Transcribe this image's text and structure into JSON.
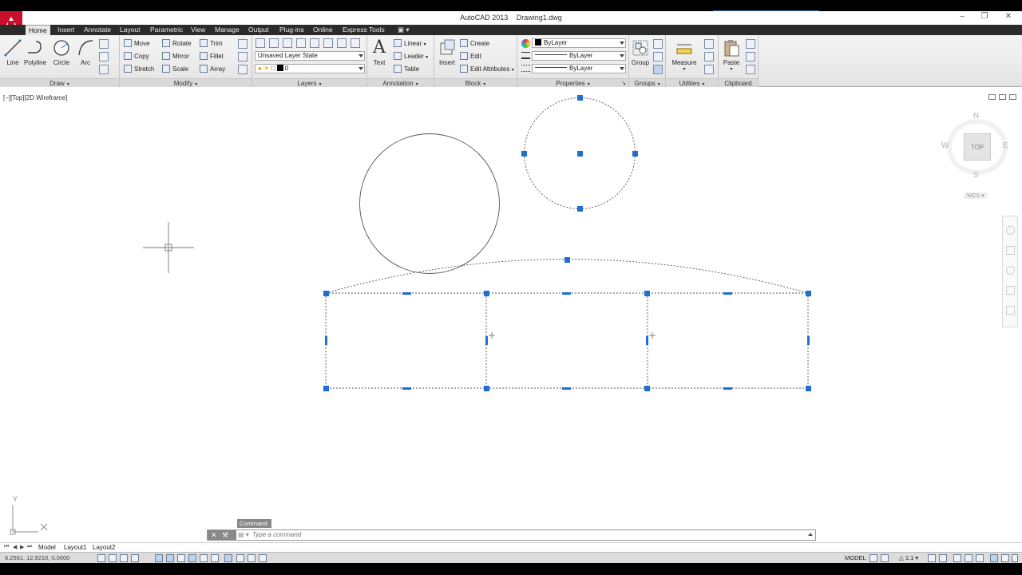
{
  "window": {
    "app_name": "AutoCAD 2013",
    "document": "Drawing1.dwg"
  },
  "tabs": [
    "Home",
    "Insert",
    "Annotate",
    "Layout",
    "Parametric",
    "View",
    "Manage",
    "Output",
    "Plug-ins",
    "Online",
    "Express Tools"
  ],
  "ribbon": {
    "draw": {
      "title": "Draw",
      "line": "Line",
      "polyline": "Polyline",
      "circle": "Circle",
      "arc": "Arc"
    },
    "modify": {
      "title": "Modify",
      "move": "Move",
      "rotate": "Rotate",
      "trim": "Trim",
      "copy": "Copy",
      "mirror": "Mirror",
      "fillet": "Fillet",
      "stretch": "Stretch",
      "scale": "Scale",
      "array": "Array"
    },
    "layers": {
      "title": "Layers",
      "layer_state": "Unsaved Layer State",
      "current_layer": "0"
    },
    "annotation": {
      "title": "Annotation",
      "text": "Text",
      "linear": "Linear",
      "leader": "Leader",
      "table": "Table"
    },
    "block": {
      "title": "Block",
      "insert": "Insert",
      "create": "Create",
      "edit": "Edit",
      "edit_attributes": "Edit Attributes"
    },
    "properties": {
      "title": "Properties",
      "color": "ByLayer",
      "linetype": "ByLayer",
      "lineweight": "ByLayer"
    },
    "groups": {
      "title": "Groups",
      "group": "Group"
    },
    "utilities": {
      "title": "Utilities",
      "measure": "Measure"
    },
    "clipboard": {
      "title": "Clipboard",
      "paste": "Paste"
    }
  },
  "viewport": {
    "label": "[−][Top][2D Wireframe]"
  },
  "viewcube": {
    "north": "N",
    "south": "S",
    "east": "E",
    "west": "W",
    "top": "TOP",
    "wcs": "WCS"
  },
  "ucs": {
    "y": "Y",
    "x": "X"
  },
  "command": {
    "history": "Command:",
    "placeholder": "Type a command"
  },
  "layout_tabs": [
    "Model",
    "Layout1",
    "Layout2"
  ],
  "status": {
    "coords": "6.2561, 12.9210, 0.0000",
    "model": "MODEL",
    "scale": "1:1"
  },
  "colors": {
    "grip": "#1e6fd0",
    "ribbon_tabbar": "#2b2b2b",
    "app_button": "#c8102e"
  }
}
